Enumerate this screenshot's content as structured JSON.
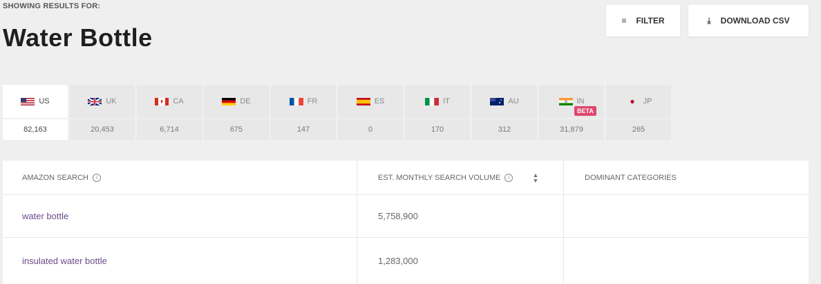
{
  "header": {
    "label": "SHOWING RESULTS FOR:",
    "title": "Water Bottle",
    "filter_label": "FILTER",
    "download_label": "DOWNLOAD CSV"
  },
  "marketplaces": [
    {
      "code": "US",
      "count": "82,163",
      "flag": "us-flag-icon",
      "active": true
    },
    {
      "code": "UK",
      "count": "20,453",
      "flag": "uk-flag-icon"
    },
    {
      "code": "CA",
      "count": "6,714",
      "flag": "ca-flag-icon"
    },
    {
      "code": "DE",
      "count": "675",
      "flag": "de-flag-icon"
    },
    {
      "code": "FR",
      "count": "147",
      "flag": "fr-flag-icon"
    },
    {
      "code": "ES",
      "count": "0",
      "flag": "es-flag-icon"
    },
    {
      "code": "IT",
      "count": "170",
      "flag": "it-flag-icon"
    },
    {
      "code": "AU",
      "count": "312",
      "flag": "au-flag-icon"
    },
    {
      "code": "IN",
      "count": "31,879",
      "flag": "in-flag-icon",
      "badge": "BETA"
    },
    {
      "code": "JP",
      "count": "265",
      "flag": "jp-flag-icon"
    }
  ],
  "table": {
    "columns": [
      "AMAZON SEARCH",
      "EST. MONTHLY SEARCH VOLUME",
      "DOMINANT CATEGORIES"
    ],
    "rows": [
      {
        "search": "water bottle",
        "volume": "5,758,900",
        "categories": ""
      },
      {
        "search": "insulated water bottle",
        "volume": "1,283,000",
        "categories": ""
      }
    ]
  },
  "colors": {
    "background": "#efefef",
    "beta_badge": "#e0466e",
    "keyword_link": "#6b4a8a"
  }
}
